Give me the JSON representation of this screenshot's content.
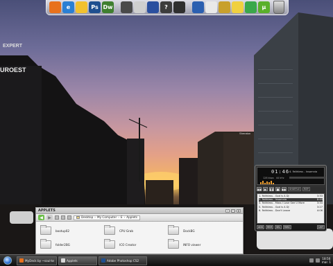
{
  "desktop": {
    "signs": [
      "EXPERT",
      "UROEST",
      "Sheraton"
    ]
  },
  "dock": {
    "icons": [
      {
        "name": "firefox-icon",
        "color": "#e8711c",
        "glyph": ""
      },
      {
        "name": "internet-explorer-icon",
        "color": "#2a7fd4",
        "glyph": "e"
      },
      {
        "name": "messenger-icon",
        "color": "#f2c12e",
        "glyph": ""
      },
      {
        "name": "photoshop-icon",
        "color": "#1f4f8f",
        "glyph": "Ps"
      },
      {
        "name": "dreamweaver-icon",
        "color": "#3f7f2f",
        "glyph": "Dw"
      },
      {
        "name": "save-disk-icon",
        "color": "#4a4a4a",
        "glyph": ""
      },
      {
        "name": "cd-drive-icon",
        "color": "#cfcfcf",
        "glyph": ""
      },
      {
        "name": "windows-icon",
        "color": "#2a4f9f",
        "glyph": ""
      },
      {
        "name": "help-icon",
        "color": "#3c3c3c",
        "glyph": "?"
      },
      {
        "name": "monitor-icon",
        "color": "#2f2f2f",
        "glyph": ""
      },
      {
        "name": "word-icon",
        "color": "#2b5fb0",
        "glyph": ""
      },
      {
        "name": "notepad-icon",
        "color": "#e9e9e9",
        "glyph": ""
      },
      {
        "name": "paint-icon",
        "color": "#c8a02c",
        "glyph": ""
      },
      {
        "name": "lightbulb-icon",
        "color": "#f0d040",
        "glyph": ""
      },
      {
        "name": "green-app-icon",
        "color": "#3aa84a",
        "glyph": ""
      },
      {
        "name": "utorrent-icon",
        "color": "#5ab02a",
        "glyph": "µ"
      }
    ]
  },
  "player": {
    "time": "01:46",
    "track": "4. Faithless - Insomnia",
    "info_left": "128 kbps",
    "info_right": "44 kHz",
    "controls": [
      "◀◀",
      "▶",
      "❚❚",
      "■",
      "▶▶"
    ],
    "toggles": [
      "SHUFFLE",
      "REP"
    ],
    "playlist": [
      {
        "title": "1. Faithless - God is A DJ",
        "time": "3:33"
      },
      {
        "title": "2. Faithless - Insomnia",
        "time": "8:40"
      },
      {
        "title": "3. Faithless - Mass I Lose See U More",
        "time": "3:34"
      },
      {
        "title": "",
        "time": ""
      },
      {
        "title": "5. Faithless - God is A DJ",
        "time": "3:27"
      },
      {
        "title": "6. Faithless - Don't Leave",
        "time": "4:06"
      }
    ],
    "active_index": 1,
    "footer_buttons": [
      "ADD",
      "REM",
      "SEL",
      "MISC"
    ],
    "footer_right": "LIST"
  },
  "explorer": {
    "title": "APPLETS",
    "breadcrumb": [
      "Desktop",
      "My Computer",
      "E",
      "Applets"
    ],
    "folders": [
      {
        "label": "bootup02"
      },
      {
        "label": "CPU Grab"
      },
      {
        "label": "DockBG"
      },
      {
        "label": "folder2BG"
      },
      {
        "label": "ICO Creator"
      },
      {
        "label": "INFO viewer"
      }
    ]
  },
  "taskbar": {
    "tasks": [
      {
        "label": "MyDeck by ~soul-keme...",
        "color": "#e8711c"
      },
      {
        "label": "Applets",
        "color": "#d8d8d8"
      },
      {
        "label": "Adobe Photoshop CS2",
        "color": "#1f4f8f"
      }
    ],
    "clock_time": "18:56",
    "clock_date": "mar. 1"
  }
}
